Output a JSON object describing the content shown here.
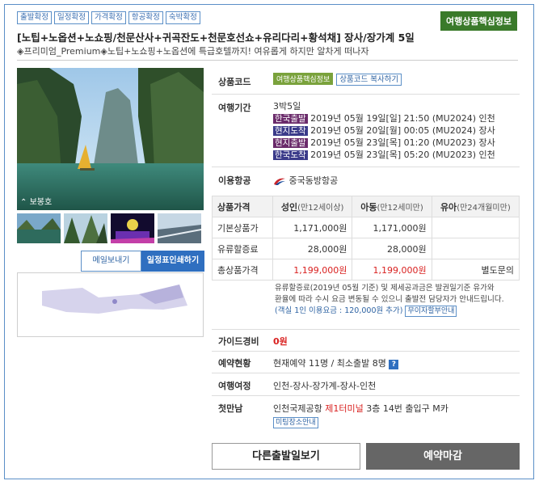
{
  "tags": [
    "출발확정",
    "일정확정",
    "가격확정",
    "항공확정",
    "숙박확정"
  ],
  "core_info_button": "여행상품핵심정보",
  "title": "[노팁+노옵션+노쇼핑/천문산사+귀곡잔도+천문호선쇼+유리다리+황석채] 장사/장가계 5일",
  "subtitle": "◈프리미엄_Premium◈노팁+노쇼핑+노옵션에 특급호텔까지! 여유롭게 하지만 알차게 떠나자",
  "photo_caption": "보봉호",
  "btn_mail": "메일보내기",
  "btn_print": "일정표인쇄하기",
  "info": {
    "product_code_label": "상품코드",
    "product_code_badge": "여행상품핵심정보",
    "copy_code_btn": "상품코드 복사하기",
    "period_label": "여행기간",
    "period_value": "3박5일",
    "schedule": [
      {
        "badge": "한국출발",
        "text": "2019년 05월 19일[일] 21:50 (MU2024) 인천"
      },
      {
        "badge": "현지도착",
        "text": "2019년 05월 20일[월] 00:05 (MU2024) 장사"
      },
      {
        "badge": "현지출발",
        "text": "2019년 05월 23일[목] 01:20 (MU2023) 장사"
      },
      {
        "badge": "한국도착",
        "text": "2019년 05월 23일[목] 05:20 (MU2023) 인천"
      }
    ],
    "airline_label": "이용항공",
    "airline_value": "중국동방항공",
    "guide_label": "가이드경비",
    "guide_value": "0원",
    "reservation_label": "예약현황",
    "reservation_value": "현재예약 11명 / 최소출발 8명",
    "route_label": "여행여정",
    "route_value": "인천-장사-장가계-장사-인천",
    "meeting_label": "첫만남",
    "meeting_value_pre": "인천국제공항 ",
    "meeting_value_red": "제1터미널",
    "meeting_value_post": " 3층 14번 출입구 M카",
    "meeting_btn": "미팅장소안내"
  },
  "price_table": {
    "headers": [
      "상품가격",
      "성인",
      "(만12세이상)",
      "아동",
      "(만12세미만)",
      "유아",
      "(만24개월미만)"
    ],
    "rows": [
      {
        "label": "기본상품가",
        "adult": "1,171,000원",
        "child": "1,171,000원",
        "infant": ""
      },
      {
        "label": "유류할증료",
        "adult": "28,000원",
        "child": "28,000원",
        "infant": ""
      },
      {
        "label": "총상품가격",
        "adult": "1,199,000원",
        "child": "1,199,000원",
        "infant": "별도문의"
      }
    ]
  },
  "note": {
    "line1": "유류할증료(2019년 05월 기준) 및 제세공과금은 발권일기준 유가와",
    "line2": "환율에 따라 수시 요금 변동될 수 있으니 출발전 담당자가 안내드립니다.",
    "single_room": "(객실 1인 이용요금 : 120,000원 추가)",
    "single_btn": "무이자할부안내"
  },
  "btn_other_dates": "다른출발일보기",
  "btn_closed": "예약마감"
}
